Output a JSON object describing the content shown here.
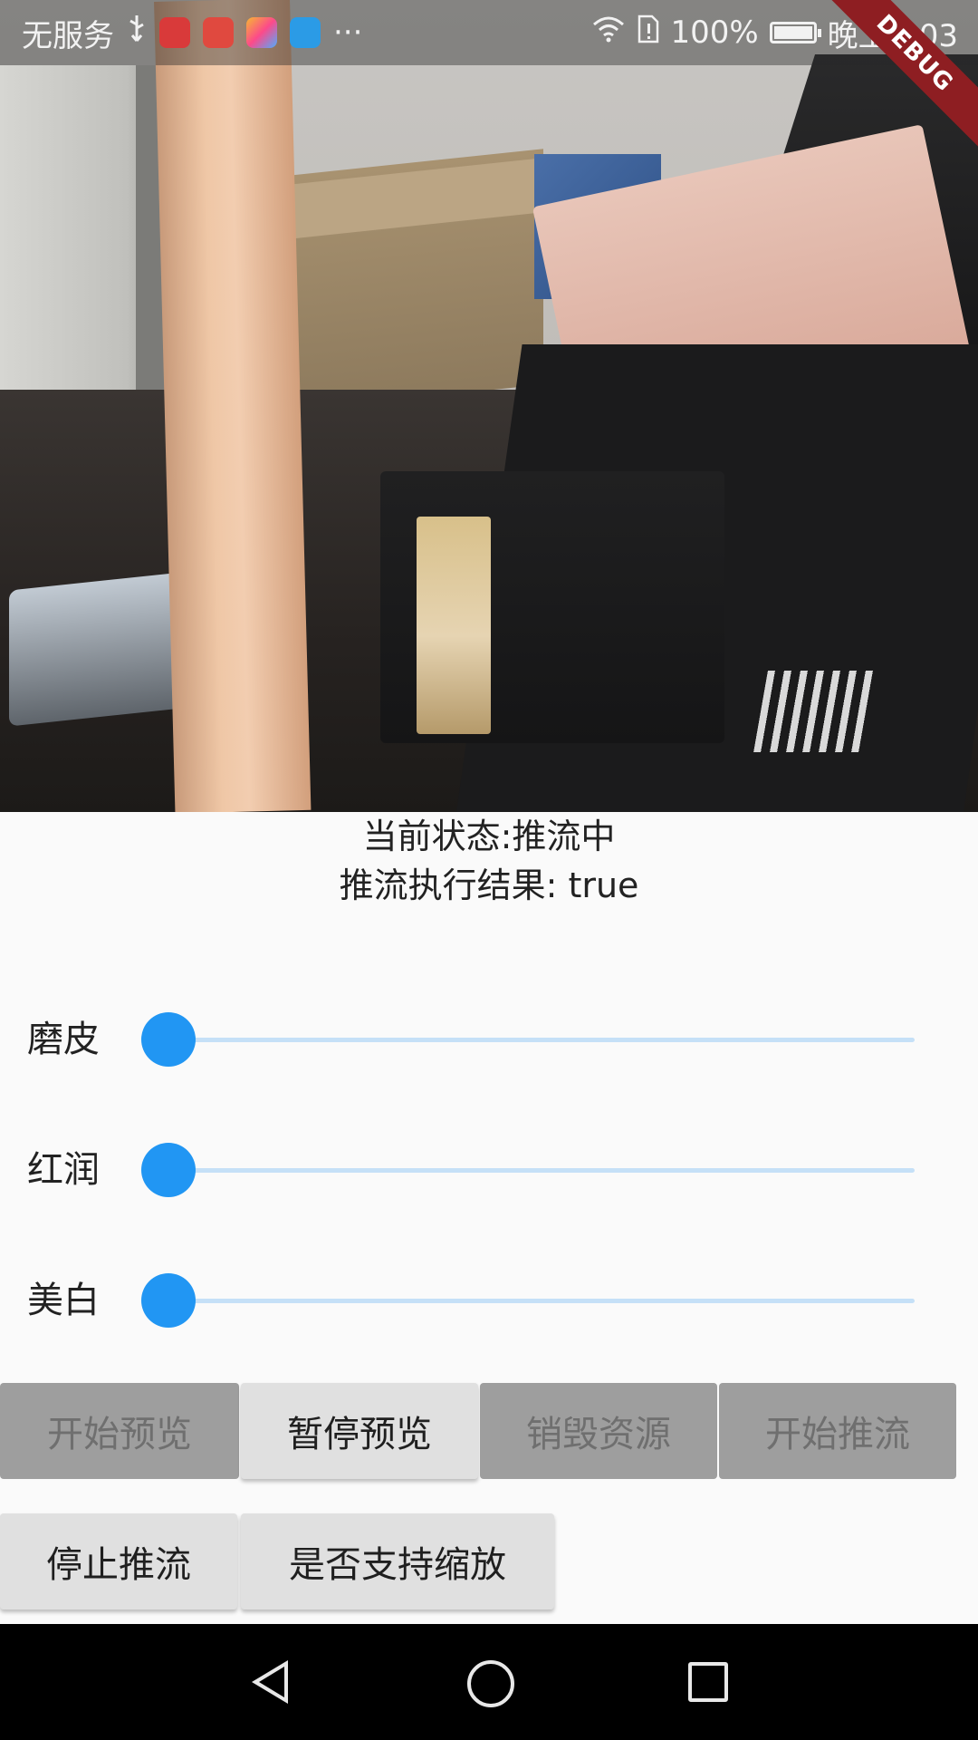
{
  "status_bar": {
    "carrier": "无服务",
    "icons": [
      "usb-icon",
      "video-app-icon",
      "huawei-app-icon",
      "photos-app-icon",
      "video-player-app-icon",
      "more-icon",
      "wifi-icon",
      "sim-alert-icon",
      "battery-icon"
    ],
    "more": "···",
    "battery_percent": "100%",
    "battery_level": 1.0,
    "time": "晚上8:03"
  },
  "debug_banner": "DEBUG",
  "stream": {
    "state_line": "当前状态:推流中",
    "result_line": "推流执行结果: true"
  },
  "sliders": [
    {
      "label": "磨皮",
      "value": 0.0
    },
    {
      "label": "红润",
      "value": 0.0
    },
    {
      "label": "美白",
      "value": 0.0
    }
  ],
  "buttons_row1": [
    {
      "label": "开始预览",
      "enabled": false
    },
    {
      "label": "暂停预览",
      "enabled": true
    },
    {
      "label": "销毁资源",
      "enabled": false
    },
    {
      "label": "开始推流",
      "enabled": false
    }
  ],
  "buttons_row2": [
    {
      "label": "停止推流",
      "enabled": true
    },
    {
      "label": "是否支持缩放",
      "enabled": true
    }
  ],
  "nav_bar": [
    "back-icon",
    "home-icon",
    "recents-icon"
  ],
  "colors": {
    "accent": "#2196f3",
    "track": "#c5e0f7",
    "button_enabled": "#e0e0e0",
    "button_disabled": "#9e9e9e",
    "debug_ribbon": "#8e1e22"
  }
}
